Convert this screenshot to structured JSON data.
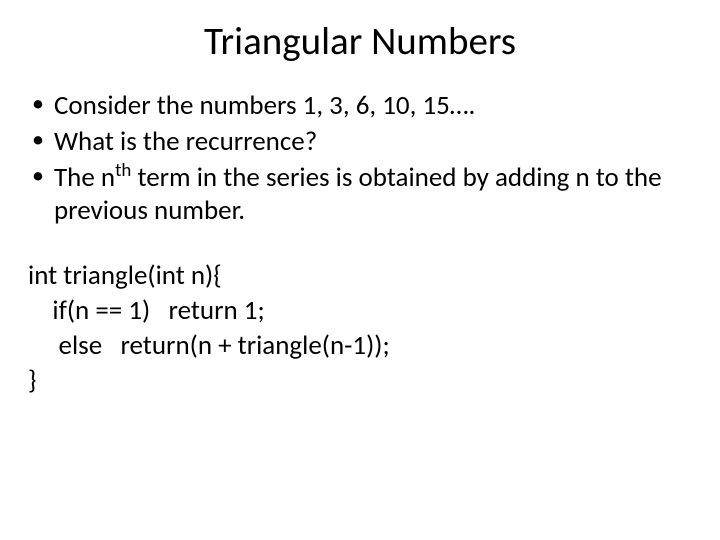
{
  "title": "Triangular Numbers",
  "bullets": [
    "Consider the numbers 1, 3, 6, 10, 15….",
    "What is the recurrence?",
    "The n__SUP__th__/SUP__ term in the series is obtained by adding n to the previous number."
  ],
  "code": [
    "int triangle(int n){",
    "    if(n == 1)   return 1;",
    "     else   return(n + triangle(n-1));",
    "}"
  ]
}
